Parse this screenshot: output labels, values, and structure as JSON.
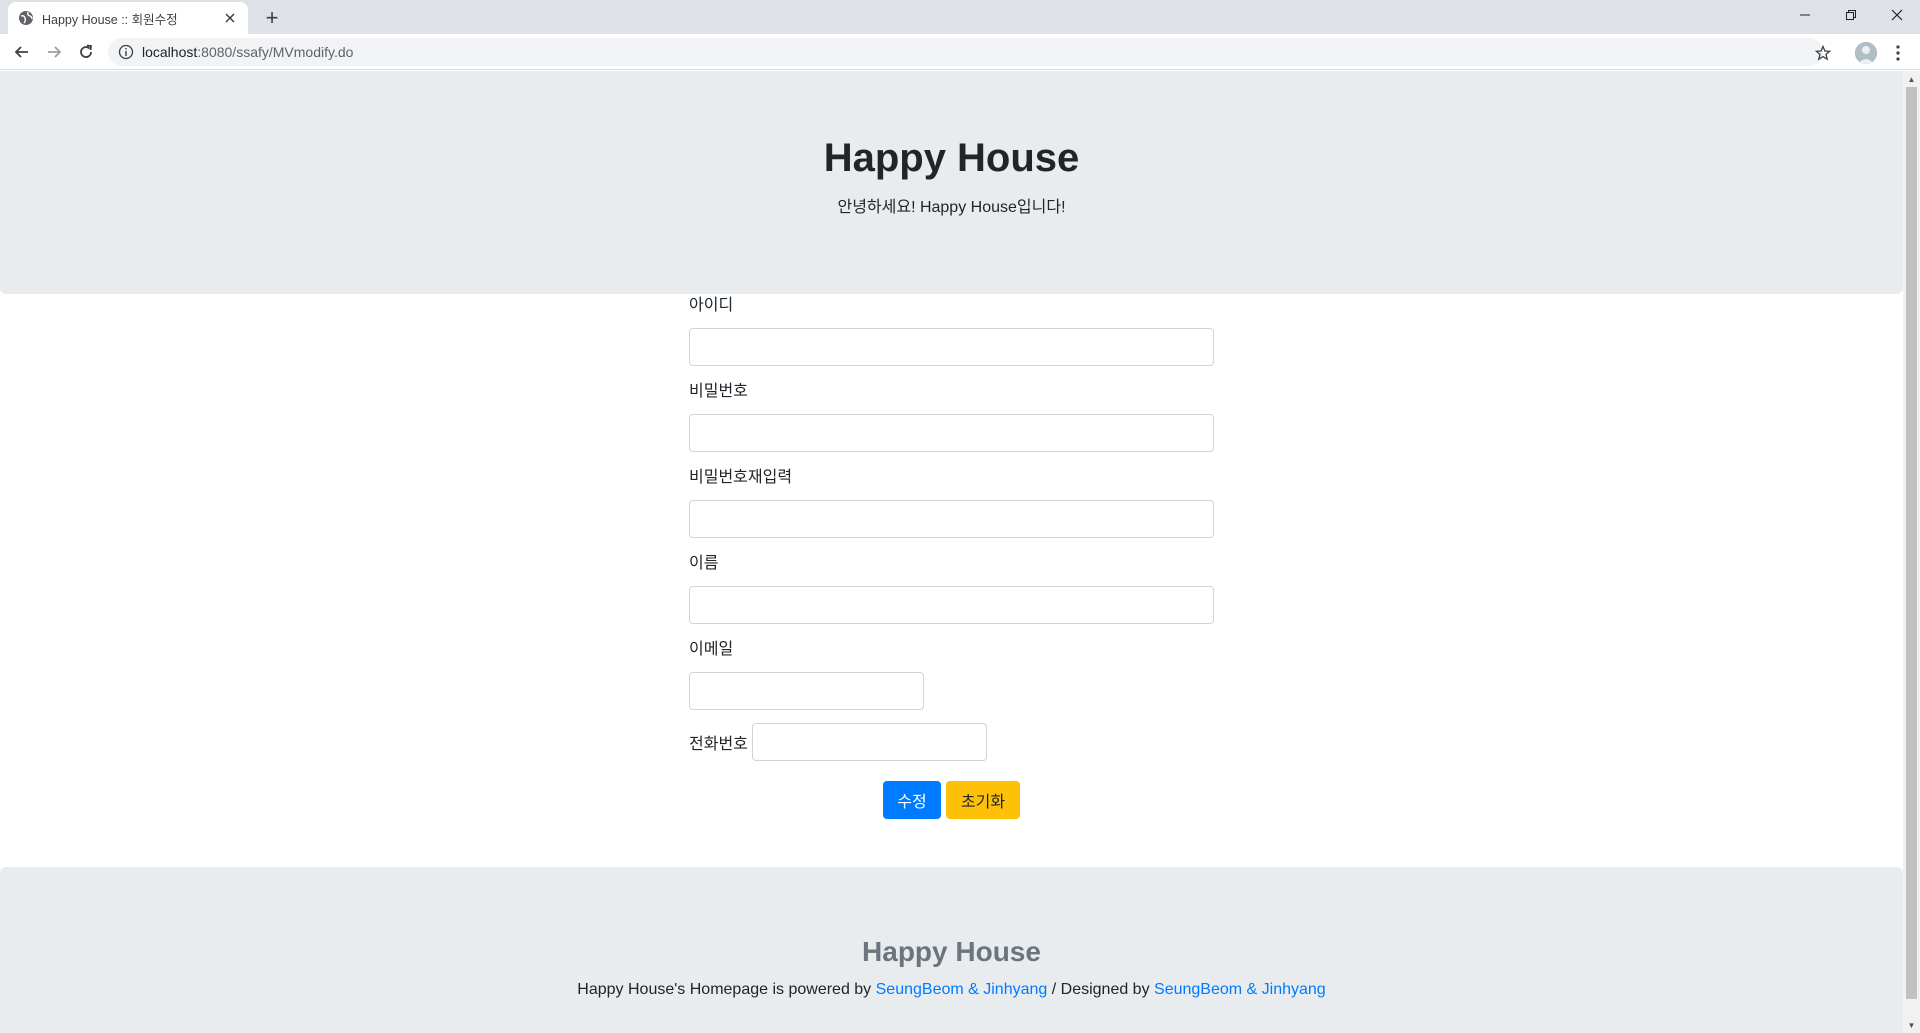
{
  "browser": {
    "tab_title": "Happy House :: 회원수정",
    "new_tab_symbol": "+",
    "close_symbol": "✕",
    "url_host": "localhost",
    "url_path": ":8080/ssafy/MVmodify.do",
    "icons": [
      "globe-icon",
      "close-icon",
      "back-arrow-icon",
      "forward-arrow-icon",
      "reload-icon",
      "info-icon",
      "star-icon",
      "avatar",
      "menu-icon",
      "minimize-icon",
      "restore-icon",
      "window-close-icon"
    ]
  },
  "header": {
    "title": "Happy House",
    "subtitle": "안녕하세요! Happy House입니다!"
  },
  "form": {
    "id_label": "아이디",
    "id_value": "",
    "password_label": "비밀번호",
    "password_value": "",
    "password_confirm_label": "비밀번호재입력",
    "password_confirm_value": "",
    "name_label": "이름",
    "name_value": "",
    "email_label": "이메일",
    "email_value": "",
    "phone_label": "전화번호",
    "phone_value": "",
    "submit_label": "수정",
    "reset_label": "초기화"
  },
  "footer": {
    "title": "Happy House",
    "text_prefix": "Happy House's Homepage is powered by ",
    "powered_by_link": "SeungBeom & Jinhyang",
    "text_middle": " / Designed by ",
    "designed_by_link": "SeungBeom & Jinhyang"
  },
  "colors": {
    "primary": "#007bff",
    "warning": "#ffc107",
    "jumbotron_bg": "#e9ecef",
    "footer_title": "#6c757d"
  }
}
